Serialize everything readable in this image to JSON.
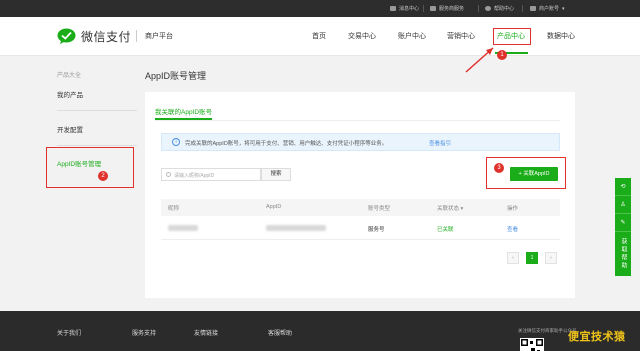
{
  "topbar": {
    "items": [
      "消息中心",
      "服务商服务",
      "帮助中心",
      "商户账号"
    ]
  },
  "header": {
    "logo_text": "微信支付",
    "platform": "商户平台",
    "nav": [
      "首页",
      "交易中心",
      "账户中心",
      "营销中心",
      "产品中心",
      "数据中心"
    ],
    "active_nav": "产品中心"
  },
  "sidebar": {
    "category": "产品大全",
    "items": [
      "我的产品",
      "开发配置",
      "AppID账号管理"
    ]
  },
  "page": {
    "title": "AppID账号管理",
    "tab": "我关联的AppID账号",
    "notice": "完成关联的AppID账号，将可用于支付、营销、用户触达、支付凭证小程序等业务。",
    "notice_link": "查看指引",
    "search_placeholder": "请输入昵称/AppID",
    "search_button": "搜索",
    "link_button": "+ 关联AppID"
  },
  "table": {
    "headers": [
      "昵称",
      "AppID",
      "账号类型",
      "关联状态 ▾",
      "操作"
    ],
    "rows": [
      {
        "type": "服务号",
        "status": "已关联",
        "action": "查看"
      }
    ]
  },
  "pagination": {
    "prev": "‹",
    "current": "1",
    "next": "›"
  },
  "annotations": [
    "1",
    "2",
    "3"
  ],
  "float_bar": {
    "label": "获取帮助"
  },
  "footer": {
    "columns": [
      "关于我们",
      "服务支持",
      "友情链接",
      "客服帮助"
    ],
    "qr_text": "关注微信支付商家助手公众号"
  },
  "watermark": "便宜技术猿",
  "colors": {
    "accent": "#1aad19",
    "annotation": "#e0312b",
    "link": "#4a90e2"
  }
}
